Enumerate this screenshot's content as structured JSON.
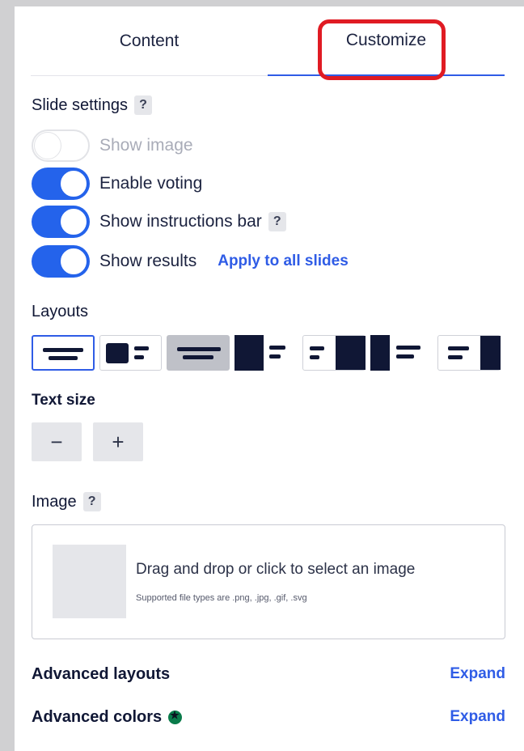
{
  "tabs": [
    {
      "label": "Content"
    },
    {
      "label": "Customize"
    }
  ],
  "slide_settings": {
    "title": "Slide settings",
    "help": "?",
    "toggles": [
      {
        "label": "Show image",
        "on": false
      },
      {
        "label": "Enable voting",
        "on": true
      },
      {
        "label": "Show instructions bar",
        "on": true,
        "help": "?"
      },
      {
        "label": "Show results",
        "on": true
      }
    ],
    "apply_link": "Apply to all slides"
  },
  "layouts": {
    "title": "Layouts",
    "options": [
      "layout-centered",
      "layout-image-left-small",
      "layout-image-background",
      "layout-image-left-large",
      "layout-image-right-small",
      "layout-image-left-full",
      "layout-image-right-full"
    ],
    "selected": "layout-centered"
  },
  "text_size": {
    "title": "Text size",
    "decrease": "−",
    "increase": "+"
  },
  "image": {
    "title": "Image",
    "help": "?",
    "drop_text": "Drag and drop or click to select an image",
    "supported": "Supported file types are .png, .jpg, .gif, .svg"
  },
  "advanced": {
    "layouts_title": "Advanced layouts",
    "colors_title": "Advanced colors",
    "expand_label": "Expand"
  },
  "colors": {
    "accent": "#2463eb",
    "highlight": "#e01b23",
    "text": "#101735"
  }
}
